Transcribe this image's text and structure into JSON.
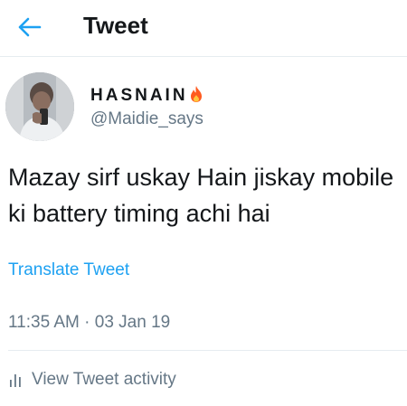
{
  "header": {
    "title": "Tweet",
    "accent_color": "#1da1f2",
    "back_icon": "arrow-left-icon"
  },
  "tweet": {
    "author": {
      "display_name": "HASNAIN",
      "name_emoji_icon": "fire-icon",
      "handle": "@Maidie_says"
    },
    "text": "Mazay sirf uskay Hain jiskay mobile ki battery timing achi hai",
    "translate_label": "Translate Tweet",
    "timestamp": "11:35 AM · 03 Jan 19",
    "activity_label": "View Tweet activity",
    "activity_icon": "bar-chart-icon"
  }
}
